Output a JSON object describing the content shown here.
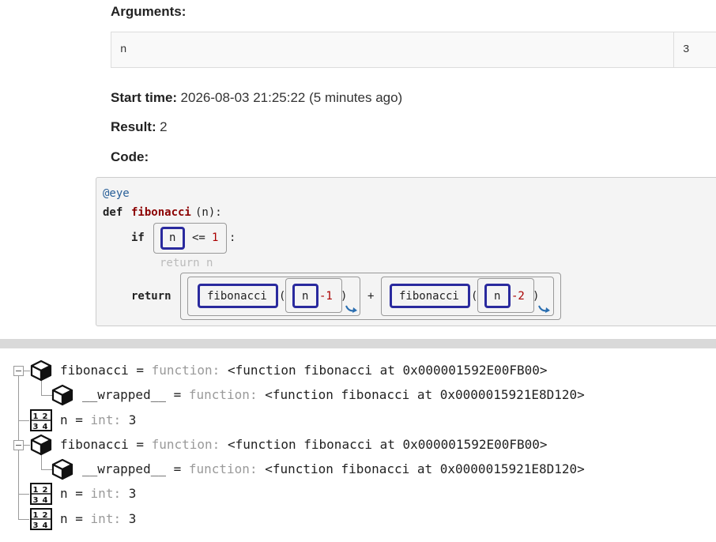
{
  "call": {
    "arguments_label": "Arguments:",
    "arguments": [
      {
        "name": "n",
        "value": "3"
      }
    ],
    "start_time_label": "Start time:",
    "start_time_value": "2026-08-03 21:25:22 (5 minutes ago)",
    "result_label": "Result:",
    "result_value": "2",
    "code_label": "Code:"
  },
  "code": {
    "decorator": "@eye",
    "def_kw": "def",
    "func_name": "fibonacci",
    "params": "(n):",
    "if_kw": "if",
    "if_var": "n",
    "if_op": "<=",
    "if_num": "1",
    "colon": ":",
    "dim_return": "return n",
    "return_kw": "return",
    "call1_fn": "fibonacci",
    "call1_arg": "n",
    "call1_num": "-1",
    "plus": "+",
    "call2_fn": "fibonacci",
    "call2_arg": "n",
    "call2_num": "-2",
    "open_paren": "(",
    "close_paren": ")"
  },
  "tree": [
    {
      "indent": 0,
      "icon": "cube-icon",
      "name": "fibonacci",
      "type": "function:",
      "value": "<function fibonacci at 0x000001592E00FB00>"
    },
    {
      "indent": 1,
      "icon": "cube-icon",
      "name": "__wrapped__",
      "type": "function:",
      "value": "<function fibonacci at 0x0000015921E8D120>"
    },
    {
      "indent": 0,
      "icon": "number-icon",
      "name": "n",
      "type": "int:",
      "value": "3"
    },
    {
      "indent": 0,
      "icon": "cube-icon",
      "name": "fibonacci",
      "type": "function:",
      "value": "<function fibonacci at 0x000001592E00FB00>"
    },
    {
      "indent": 1,
      "icon": "cube-icon",
      "name": "__wrapped__",
      "type": "function:",
      "value": "<function fibonacci at 0x0000015921E8D120>"
    },
    {
      "indent": 0,
      "icon": "number-icon",
      "name": "n",
      "type": "int:",
      "value": "3"
    },
    {
      "indent": 0,
      "icon": "number-icon",
      "name": "n",
      "type": "int:",
      "value": "3"
    }
  ],
  "tree_eq": "=",
  "number_icon_digits": [
    "1",
    "2",
    "3",
    "4"
  ]
}
